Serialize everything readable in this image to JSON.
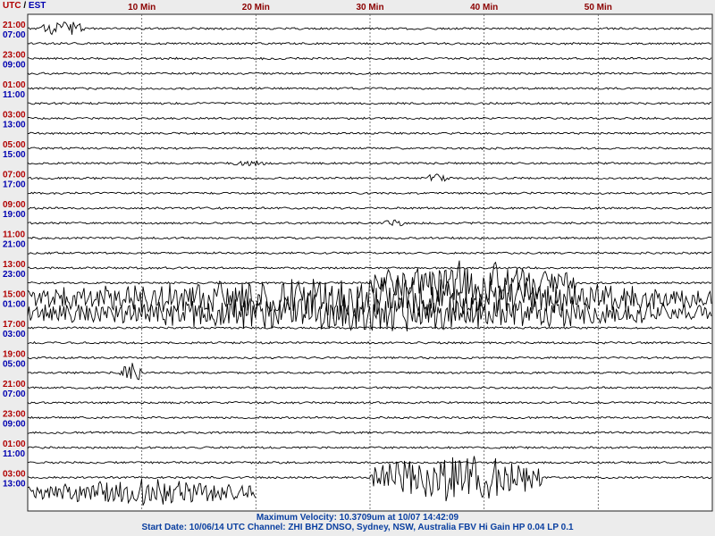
{
  "header": {
    "utc_label": "UTC",
    "separator": "/",
    "est_label": "EST"
  },
  "minute_labels": [
    "10 Min",
    "20 Min",
    "30 Min",
    "40 Min",
    "50 Min"
  ],
  "utc_times": [
    "21:00",
    "23:00",
    "01:00",
    "03:00",
    "05:00",
    "07:00",
    "09:00",
    "11:00",
    "13:00",
    "15:00",
    "17:00",
    "19:00",
    "21:00",
    "23:00",
    "01:00",
    "03:00"
  ],
  "est_times": [
    "07:00",
    "09:00",
    "11:00",
    "13:00",
    "15:00",
    "17:00",
    "19:00",
    "21:00",
    "23:00",
    "01:00",
    "03:00",
    "05:00",
    "07:00",
    "09:00",
    "11:00",
    "13:00"
  ],
  "footer": {
    "line1": "Maximum Velocity: 10.3709um at 10/07 14:42:09",
    "line2": "Start Date: 10/06/14 UTC Channel: ZHI  BHZ  DNSO, Sydney, NSW, Australia  FBV Hi Gain HP 0.04 LP 0.1"
  },
  "colors": {
    "utc": "#b00000",
    "est": "#0000b0",
    "trace": "#000000",
    "footer": "#0a3fa0",
    "grid": "#555555"
  },
  "chart_data": {
    "type": "line",
    "description_type": "helicorder",
    "xlim": [
      0,
      60
    ],
    "x_unit": "Min",
    "trace_count": 32,
    "events": [
      {
        "trace": 0,
        "minute_start": 1,
        "minute_end": 5,
        "amplitude": 0.35
      },
      {
        "trace": 9,
        "minute_start": 18,
        "minute_end": 21,
        "amplitude": 0.1
      },
      {
        "trace": 10,
        "minute_start": 35,
        "minute_end": 37,
        "amplitude": 0.2
      },
      {
        "trace": 13,
        "minute_start": 31,
        "minute_end": 33,
        "amplitude": 0.15
      },
      {
        "trace": 17,
        "minute_start": 30,
        "minute_end": 48,
        "amplitude": 1.0
      },
      {
        "trace": 18,
        "minute_start": 0,
        "minute_end": 60,
        "amplitude": 0.9
      },
      {
        "trace": 19,
        "minute_start": 0,
        "minute_end": 60,
        "amplitude": 0.8
      },
      {
        "trace": 23,
        "minute_start": 8,
        "minute_end": 10,
        "amplitude": 0.5
      },
      {
        "trace": 30,
        "minute_start": 30,
        "minute_end": 45,
        "amplitude": 1.1
      },
      {
        "trace": 31,
        "minute_start": 0,
        "minute_end": 20,
        "amplitude": 0.6
      }
    ]
  }
}
